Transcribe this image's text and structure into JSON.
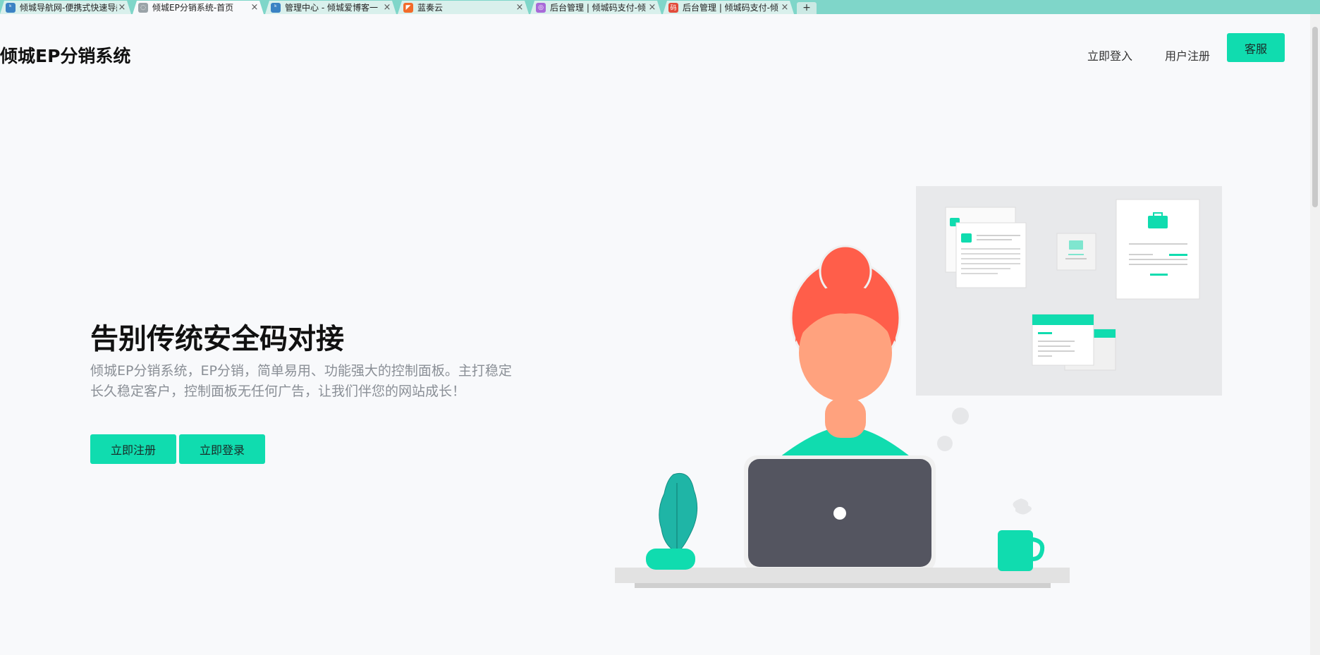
{
  "browser": {
    "tabs": [
      {
        "title": "倾城导航网-便携式快速导航",
        "favicon_color": "#3b82c4",
        "favicon_text": "ᵏ",
        "active": false
      },
      {
        "title": "倾城EP分销系统-首页",
        "favicon_color": "#9aa3a8",
        "favicon_text": "◌",
        "active": true
      },
      {
        "title": "管理中心 - 倾城爱博客一",
        "favicon_color": "#3b82c4",
        "favicon_text": "ᵏ",
        "active": false
      },
      {
        "title": "蓝奏云",
        "favicon_color": "#f26b2a",
        "favicon_text": "◤",
        "active": false
      },
      {
        "title": "后台管理 | 倾城码支付-倾",
        "favicon_color": "#a86ad8",
        "favicon_text": "◎",
        "active": false
      },
      {
        "title": "后台管理 | 倾城码支付-倾",
        "favicon_color": "#e24b3b",
        "favicon_text": "码",
        "active": false
      }
    ],
    "close_glyph": "×",
    "new_tab_glyph": "+"
  },
  "header": {
    "logo_text": "倾城EP分销系统",
    "nav_login": "立即登入",
    "nav_register": "用户注册",
    "service_button": "客服"
  },
  "hero": {
    "title": "告别传统安全码对接",
    "description": "倾城EP分销系统，EP分销，简单易用、功能强大的控制面板。主打稳定长久稳定客户，控制面板无任何广告，让我们伴您的网站成长！",
    "register_button": "立即注册",
    "login_button": "立即登录"
  },
  "colors": {
    "accent": "#10dcaf",
    "hair": "#ff5e4a",
    "skin": "#ffa27e",
    "laptop": "#545560",
    "plant": "#1fb5a6",
    "board": "#e8e9eb"
  },
  "illustration": {
    "name": "woman-at-laptop-illustration"
  }
}
